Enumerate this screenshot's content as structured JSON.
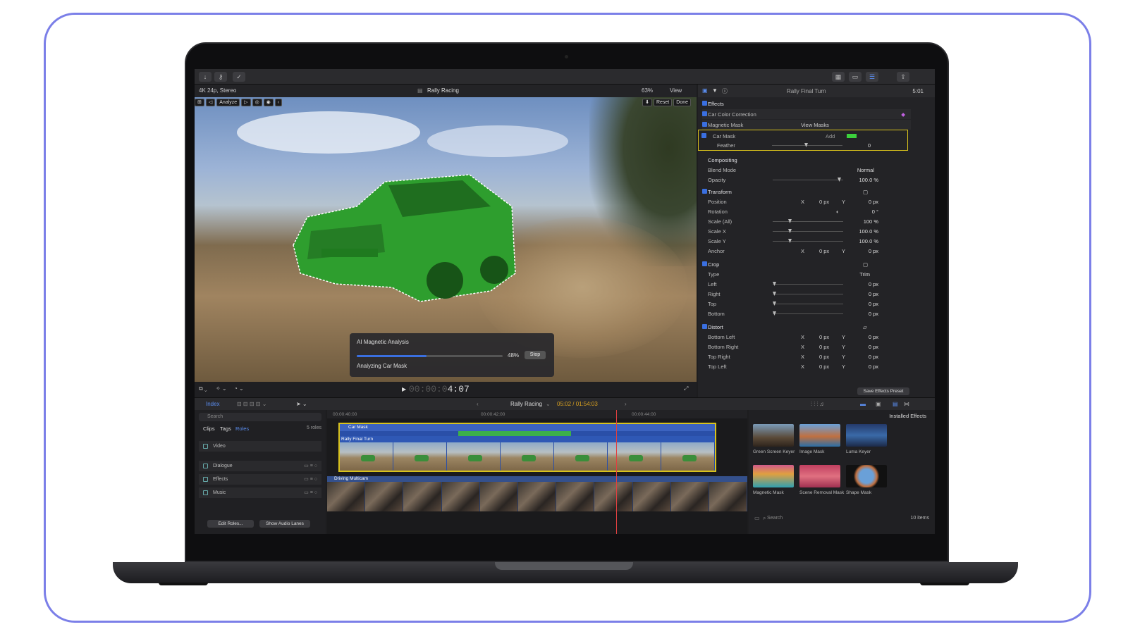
{
  "toolbar": {
    "import_icon": "download-arrow-icon",
    "keyword_icon": "key-icon",
    "check_icon": "checkmark-circle-icon"
  },
  "viewer": {
    "format": "4K 24p, Stereo",
    "title": "Rally Racing",
    "zoom": "63%",
    "view_label": "View",
    "analyze_label": "Analyze",
    "reset_label": "Reset",
    "done_label": "Done",
    "timecode_dim": "00:00:0",
    "timecode": "4:07",
    "analysis": {
      "title": "AI Magnetic Analysis",
      "progress": 48,
      "percent": "48%",
      "stop_label": "Stop",
      "subtitle": "Analyzing Car Mask"
    }
  },
  "inspector": {
    "clip_name": "Rally Final Turn",
    "duration": "5:01",
    "effects_label": "Effects",
    "car_color_correction": "Car Color Correction",
    "magnetic_mask": "Magnetic Mask",
    "view_masks": "View Masks",
    "car_mask": "Car Mask",
    "add_label": "Add",
    "feather_label": "Feather",
    "feather_value": "0",
    "compositing": "Compositing",
    "blend_mode_label": "Blend Mode",
    "blend_mode_value": "Normal",
    "opacity_label": "Opacity",
    "opacity_value": "100.0 %",
    "transform": "Transform",
    "position_label": "Position",
    "position_x": "0 px",
    "position_y": "0 px",
    "rotation_label": "Rotation",
    "rotation_value": "0 °",
    "scale_all_label": "Scale (All)",
    "scale_all_value": "100 %",
    "scale_x_label": "Scale X",
    "scale_x_value": "100.0 %",
    "scale_y_label": "Scale Y",
    "scale_y_value": "100.0 %",
    "anchor_label": "Anchor",
    "anchor_x": "0 px",
    "anchor_y": "0 px",
    "crop": "Crop",
    "type_label": "Type",
    "type_value": "Trim",
    "left_label": "Left",
    "right_label": "Right",
    "top_label": "Top",
    "bottom_label": "Bottom",
    "crop_value": "0 px",
    "distort": "Distort",
    "bottom_left": "Bottom Left",
    "bottom_right": "Bottom Right",
    "top_right": "Top Right",
    "top_left": "Top Left",
    "distort_value": "0 px",
    "x_label": "X",
    "y_label": "Y",
    "save_preset": "Save Effects Preset"
  },
  "timeline": {
    "index_tab": "Index",
    "project": "Rally Racing",
    "position": "05:02 / 01:54:03",
    "ruler": [
      "00:00:40:00",
      "00:00:42:00",
      "00:00:44:00"
    ],
    "search_placeholder": "Search",
    "tabs": [
      "Clips",
      "Tags",
      "Roles"
    ],
    "roles_count": "5 roles",
    "roles": [
      "Video",
      "Dialogue",
      "Effects",
      "Music"
    ],
    "edit_roles": "Edit Roles...",
    "show_audio_lanes": "Show Audio Lanes",
    "clip_mask": "Car Mask",
    "clip_name": "Rally Final Turn",
    "clip_multicam": "Driving Multicam"
  },
  "effects_browser": {
    "title": "Installed Effects",
    "items": [
      "Green Screen Keyer",
      "Image Mask",
      "Luma Keyer",
      "Magnetic Mask",
      "Scene Removal Mask",
      "Shape Mask"
    ],
    "search_placeholder": "Search",
    "count": "10 items"
  },
  "colors": {
    "accent": "#3a6fe0",
    "selection": "#d8c21c",
    "mask_green": "#2e9e2e",
    "frame": "#7b7fe8"
  }
}
